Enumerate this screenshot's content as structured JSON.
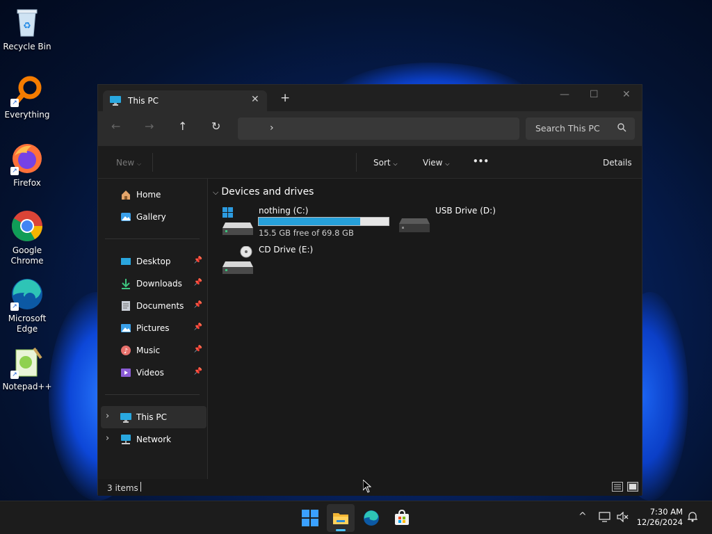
{
  "desktop": {
    "icons": [
      {
        "label": "Recycle Bin"
      },
      {
        "label": "Everything"
      },
      {
        "label": "Firefox"
      },
      {
        "label": "Google Chrome"
      },
      {
        "label": "Microsoft Edge"
      },
      {
        "label": "Notepad++"
      }
    ]
  },
  "window": {
    "tab_title": "This PC",
    "tab_close": "✕",
    "new_tab": "+",
    "controls": {
      "minimize": "—",
      "maximize": "☐",
      "close": "✕"
    },
    "nav": {
      "back": "←",
      "forward": "→",
      "up": "↑",
      "refresh": "↻"
    },
    "address_chevron": "›",
    "search_placeholder": "Search This PC",
    "command_bar": {
      "new": "New",
      "sort": "Sort",
      "view": "View",
      "more": "•••",
      "details": "Details"
    },
    "nav_pane": {
      "items": [
        {
          "label": "Home"
        },
        {
          "label": "Gallery"
        },
        {
          "label": "Desktop"
        },
        {
          "label": "Downloads"
        },
        {
          "label": "Documents"
        },
        {
          "label": "Pictures"
        },
        {
          "label": "Music"
        },
        {
          "label": "Videos"
        },
        {
          "label": "This PC"
        },
        {
          "label": "Network"
        }
      ]
    },
    "content": {
      "group_title": "Devices and drives",
      "drives": [
        {
          "name": "nothing (C:)",
          "free_text": "15.5 GB free of 69.8 GB",
          "used_fraction": 0.78
        },
        {
          "name": "USB Drive (D:)"
        },
        {
          "name": "CD Drive (E:)"
        }
      ]
    },
    "status": {
      "count": "3 items"
    }
  },
  "taskbar": {
    "time": "7:30 AM",
    "date": "12/26/2024",
    "tray_up": "^"
  },
  "colors": {
    "accent": "#26a0da",
    "indicator": "#4cc2ff"
  }
}
